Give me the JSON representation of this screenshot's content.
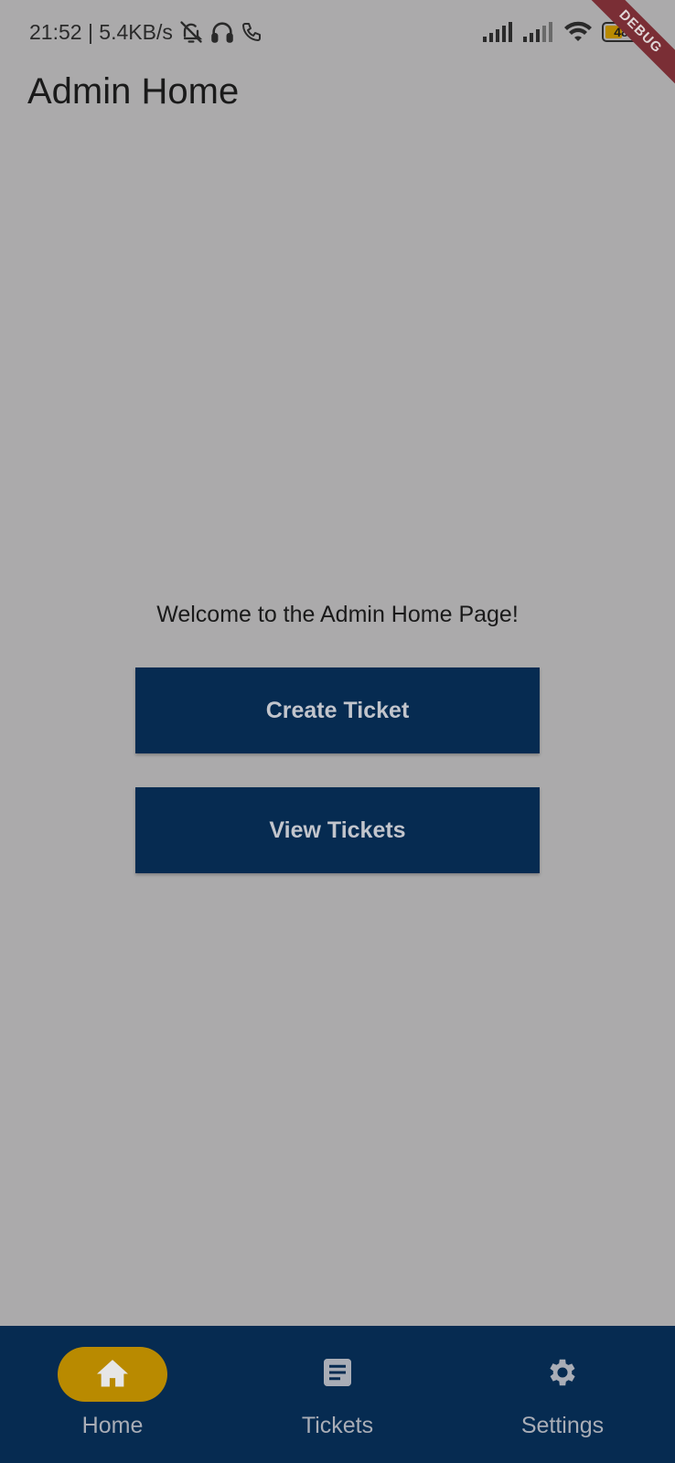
{
  "status_bar": {
    "time_speed": "21:52 | 5.4KB/s",
    "battery_level": "48",
    "icons": [
      "mute-bell-icon",
      "headphones-icon",
      "phone-icon",
      "signal-icon",
      "signal-icon",
      "wifi-icon",
      "battery-icon"
    ]
  },
  "debug_banner": "DEBUG",
  "app_bar": {
    "title": "Admin Home"
  },
  "main": {
    "welcome": "Welcome to the Admin Home Page!",
    "create_ticket_label": "Create Ticket",
    "view_tickets_label": "View Tickets"
  },
  "bottom_nav": {
    "items": [
      {
        "label": "Home",
        "icon": "home-icon",
        "active": true
      },
      {
        "label": "Tickets",
        "icon": "article-icon",
        "active": false
      },
      {
        "label": "Settings",
        "icon": "gear-icon",
        "active": false
      }
    ]
  },
  "colors": {
    "background": "#ABAAAB",
    "primary": "#062B51",
    "accent": "#B98A00",
    "debug_ribbon": "#7A2E35"
  }
}
